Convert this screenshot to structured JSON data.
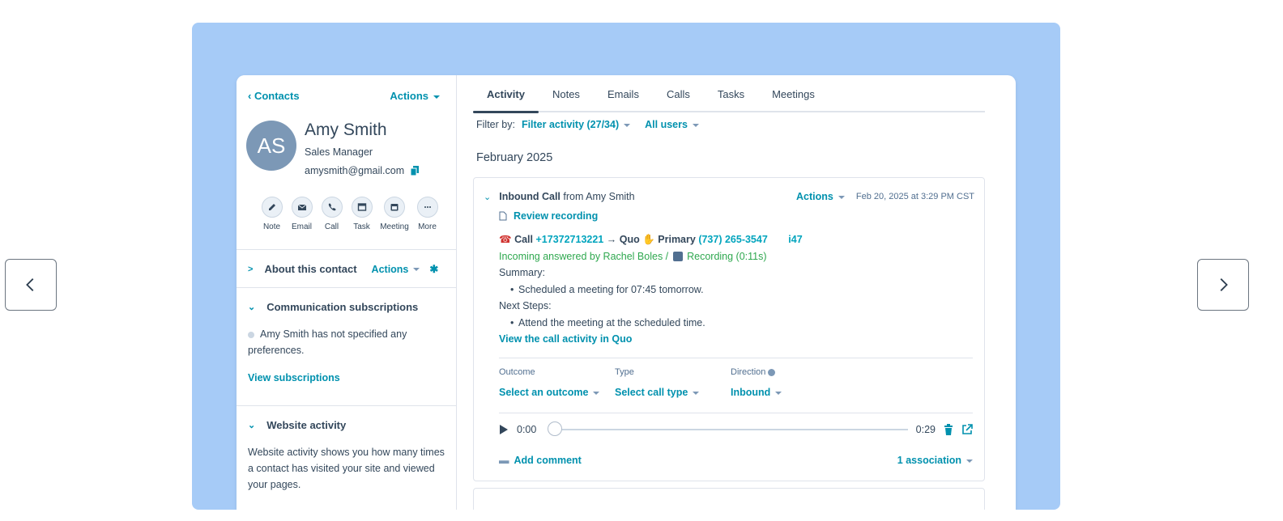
{
  "left_panel": {
    "breadcrumb": "Contacts",
    "actions_label": "Actions",
    "avatar_initials": "AS",
    "contact_name": "Amy Smith",
    "job_title": "Sales Manager",
    "email": "amysmith@gmail.com",
    "quick_actions": [
      "Note",
      "Email",
      "Call",
      "Task",
      "Meeting",
      "More"
    ],
    "about": {
      "title": "About this contact",
      "actions_label": "Actions"
    },
    "comm": {
      "title": "Communication subscriptions",
      "text": "Amy Smith has not specified any preferences.",
      "link": "View subscriptions"
    },
    "website": {
      "title": "Website activity",
      "text": "Website activity shows you how many times a contact has visited your site and viewed your pages."
    }
  },
  "tabs": [
    "Activity",
    "Notes",
    "Emails",
    "Calls",
    "Tasks",
    "Meetings"
  ],
  "filter": {
    "label": "Filter by:",
    "activity": "Filter activity (27/34)",
    "users": "All users"
  },
  "month": "February 2025",
  "activity": {
    "title_bold": "Inbound Call",
    "title_rest": "from Amy Smith",
    "actions_label": "Actions",
    "date": "Feb 20, 2025 at 3:29 PM CST",
    "review_label": "Review recording",
    "call_word": "Call",
    "call_number": "+17372713221",
    "arrow_text": "→ Quo",
    "primary_word": "Primary",
    "primary_number": "(737) 265-3547",
    "truncated": "i47",
    "incoming_text": "Incoming answered by Rachel Boles /",
    "recording_text": "Recording (0:11s)",
    "summary_label": "Summary:",
    "summary_item": "Scheduled a meeting for 07:45 tomorrow.",
    "next_label": "Next Steps:",
    "next_item": "Attend the meeting at the scheduled time.",
    "view_link": "View the call activity in Quo",
    "outcome_label": "Outcome",
    "outcome_value": "Select an outcome",
    "type_label": "Type",
    "type_value": "Select call type",
    "direction_label": "Direction",
    "direction_value": "Inbound",
    "time_start": "0:00",
    "time_end": "0:29",
    "add_comment": "Add comment",
    "association": "1 association"
  },
  "colors": {
    "accent": "#0091ae",
    "frame": "#a6cbf7",
    "text": "#33475b"
  }
}
